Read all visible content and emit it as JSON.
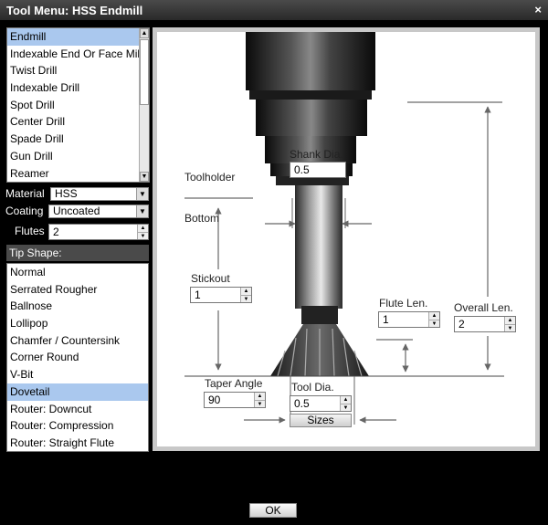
{
  "window": {
    "title": "Tool Menu: HSS Endmill",
    "close_label": "×"
  },
  "tool_types": {
    "items": [
      "Endmill",
      "Indexable End Or Face Mill",
      "Twist Drill",
      "Indexable Drill",
      "Spot Drill",
      "Center Drill",
      "Spade Drill",
      "Gun Drill",
      "Reamer"
    ],
    "selected": "Endmill"
  },
  "material": {
    "label": "Material",
    "value": "HSS"
  },
  "coating": {
    "label": "Coating",
    "value": "Uncoated"
  },
  "flutes": {
    "label": "Flutes",
    "value": "2"
  },
  "tip_shape": {
    "header": "Tip Shape:",
    "items": [
      "Normal",
      "Serrated Rougher",
      "Ballnose",
      "Lollipop",
      "Chamfer / Countersink",
      "Corner Round",
      "V-Bit",
      "Dovetail",
      "Router: Downcut",
      "Router: Compression",
      "Router: Straight Flute"
    ],
    "selected": "Dovetail"
  },
  "diagram": {
    "toolholder_label": "Toolholder",
    "bottom_label": "Bottom",
    "shank_dia": {
      "label": "Shank Dia.",
      "value": "0.5"
    },
    "stickout": {
      "label": "Stickout",
      "value": "1"
    },
    "flute_len": {
      "label": "Flute Len.",
      "value": "1"
    },
    "overall_len": {
      "label": "Overall Len.",
      "value": "2"
    },
    "taper_angle": {
      "label": "Taper Angle",
      "value": "90"
    },
    "tool_dia": {
      "label": "Tool Dia.",
      "value": "0.5"
    },
    "sizes_label": "Sizes"
  },
  "ok_label": "OK"
}
